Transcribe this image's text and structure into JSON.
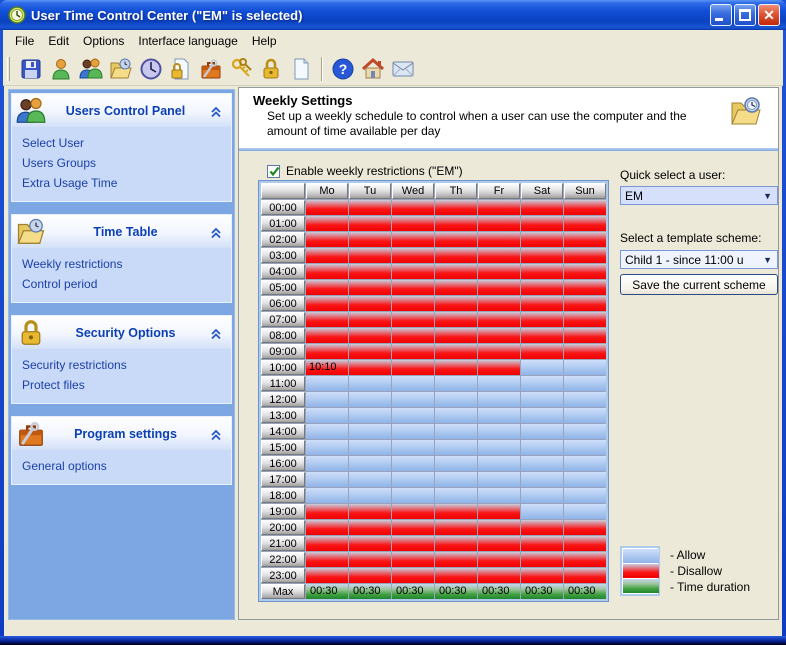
{
  "window": {
    "title": "User Time Control Center (\"EM\" is selected)",
    "app_icon": "clock-app-icon",
    "controls": [
      "minimize",
      "maximize",
      "close"
    ],
    "menu": [
      "File",
      "Edit",
      "Options",
      "Interface language",
      "Help"
    ],
    "toolbar": [
      {
        "icon": "save-icon"
      },
      {
        "icon": "user-icon"
      },
      {
        "icon": "users-icon"
      },
      {
        "icon": "folder-clock-icon"
      },
      {
        "icon": "clock-icon"
      },
      {
        "icon": "page-lock-icon"
      },
      {
        "icon": "toolbox-icon"
      },
      {
        "icon": "keys-icon"
      },
      {
        "icon": "padlock-icon"
      },
      {
        "icon": "new-page-icon"
      },
      {
        "sep": true
      },
      {
        "icon": "help-icon"
      },
      {
        "icon": "home-icon"
      },
      {
        "icon": "mail-icon"
      }
    ]
  },
  "sidebar": {
    "panels": [
      {
        "title": "Users Control Panel",
        "icon": "users-icon",
        "items": [
          "Select User",
          "Users Groups",
          "Extra Usage Time"
        ]
      },
      {
        "title": "Time Table",
        "icon": "folder-clock-icon",
        "items": [
          "Weekly restrictions",
          "Control period"
        ]
      },
      {
        "title": "Security Options",
        "icon": "padlock-icon",
        "items": [
          "Security restrictions",
          "Protect files"
        ]
      },
      {
        "title": "Program settings",
        "icon": "toolbox-icon",
        "items": [
          "General options"
        ]
      }
    ]
  },
  "main": {
    "header": {
      "title": "Weekly Settings",
      "subtitle": "Set up a weekly schedule to control when a user can use the computer and the amount of time available per day",
      "icon": "folder-clock-icon"
    },
    "enable_checkbox": {
      "checked": true,
      "label": "Enable weekly restrictions (\"EM\")"
    },
    "quick_select": {
      "label": "Quick select a user:",
      "value": "EM"
    },
    "template_scheme": {
      "label": "Select a template scheme:",
      "value": "Child 1  - since 11:00 u"
    },
    "save_button_label": "Save the current scheme",
    "legend": [
      {
        "state": "allow",
        "label": "- Allow"
      },
      {
        "state": "deny",
        "label": "- Disallow"
      },
      {
        "state": "duration",
        "label": "- Time duration"
      }
    ]
  },
  "schedule": {
    "days": [
      "Mo",
      "Tu",
      "Wed",
      "Th",
      "Fr",
      "Sat",
      "Sun"
    ],
    "max_row_label": "Max",
    "max_values": [
      "00:30",
      "00:30",
      "00:30",
      "00:30",
      "00:30",
      "00:30",
      "00:30"
    ],
    "cell_labels": [
      {
        "hour": "10:00",
        "day": "Mo",
        "text": "10:10"
      }
    ],
    "rows": [
      {
        "hour": "00:00",
        "cells": [
          "D",
          "D",
          "D",
          "D",
          "D",
          "D",
          "D"
        ]
      },
      {
        "hour": "01:00",
        "cells": [
          "D",
          "D",
          "D",
          "D",
          "D",
          "D",
          "D"
        ]
      },
      {
        "hour": "02:00",
        "cells": [
          "D",
          "D",
          "D",
          "D",
          "D",
          "D",
          "D"
        ]
      },
      {
        "hour": "03:00",
        "cells": [
          "D",
          "D",
          "D",
          "D",
          "D",
          "D",
          "D"
        ]
      },
      {
        "hour": "04:00",
        "cells": [
          "D",
          "D",
          "D",
          "D",
          "D",
          "D",
          "D"
        ]
      },
      {
        "hour": "05:00",
        "cells": [
          "D",
          "D",
          "D",
          "D",
          "D",
          "D",
          "D"
        ]
      },
      {
        "hour": "06:00",
        "cells": [
          "D",
          "D",
          "D",
          "D",
          "D",
          "D",
          "D"
        ]
      },
      {
        "hour": "07:00",
        "cells": [
          "D",
          "D",
          "D",
          "D",
          "D",
          "D",
          "D"
        ]
      },
      {
        "hour": "08:00",
        "cells": [
          "D",
          "D",
          "D",
          "D",
          "D",
          "D",
          "D"
        ]
      },
      {
        "hour": "09:00",
        "cells": [
          "D",
          "D",
          "D",
          "D",
          "D",
          "D",
          "D"
        ]
      },
      {
        "hour": "10:00",
        "cells": [
          "D",
          "D",
          "D",
          "D",
          "D",
          "A",
          "A"
        ]
      },
      {
        "hour": "11:00",
        "cells": [
          "A",
          "A",
          "A",
          "A",
          "A",
          "A",
          "A"
        ]
      },
      {
        "hour": "12:00",
        "cells": [
          "A",
          "A",
          "A",
          "A",
          "A",
          "A",
          "A"
        ]
      },
      {
        "hour": "13:00",
        "cells": [
          "A",
          "A",
          "A",
          "A",
          "A",
          "A",
          "A"
        ]
      },
      {
        "hour": "14:00",
        "cells": [
          "A",
          "A",
          "A",
          "A",
          "A",
          "A",
          "A"
        ]
      },
      {
        "hour": "15:00",
        "cells": [
          "A",
          "A",
          "A",
          "A",
          "A",
          "A",
          "A"
        ]
      },
      {
        "hour": "16:00",
        "cells": [
          "A",
          "A",
          "A",
          "A",
          "A",
          "A",
          "A"
        ]
      },
      {
        "hour": "17:00",
        "cells": [
          "A",
          "A",
          "A",
          "A",
          "A",
          "A",
          "A"
        ]
      },
      {
        "hour": "18:00",
        "cells": [
          "A",
          "A",
          "A",
          "A",
          "A",
          "A",
          "A"
        ]
      },
      {
        "hour": "19:00",
        "cells": [
          "D",
          "D",
          "D",
          "D",
          "D",
          "A",
          "A"
        ]
      },
      {
        "hour": "20:00",
        "cells": [
          "D",
          "D",
          "D",
          "D",
          "D",
          "D",
          "D"
        ]
      },
      {
        "hour": "21:00",
        "cells": [
          "D",
          "D",
          "D",
          "D",
          "D",
          "D",
          "D"
        ]
      },
      {
        "hour": "22:00",
        "cells": [
          "D",
          "D",
          "D",
          "D",
          "D",
          "D",
          "D"
        ]
      },
      {
        "hour": "23:00",
        "cells": [
          "D",
          "D",
          "D",
          "D",
          "D",
          "D",
          "D"
        ]
      }
    ]
  },
  "colors": {
    "allow": "#9dbde8",
    "disallow": "#f40000",
    "time_duration": "#2e9b2e",
    "titlebar_blue": "#1250d8",
    "sidebar_bg": "#7da7e2",
    "panel_title": "#0c3fb4",
    "link": "#1b3fa8",
    "content_bg": "#ece9d8"
  }
}
